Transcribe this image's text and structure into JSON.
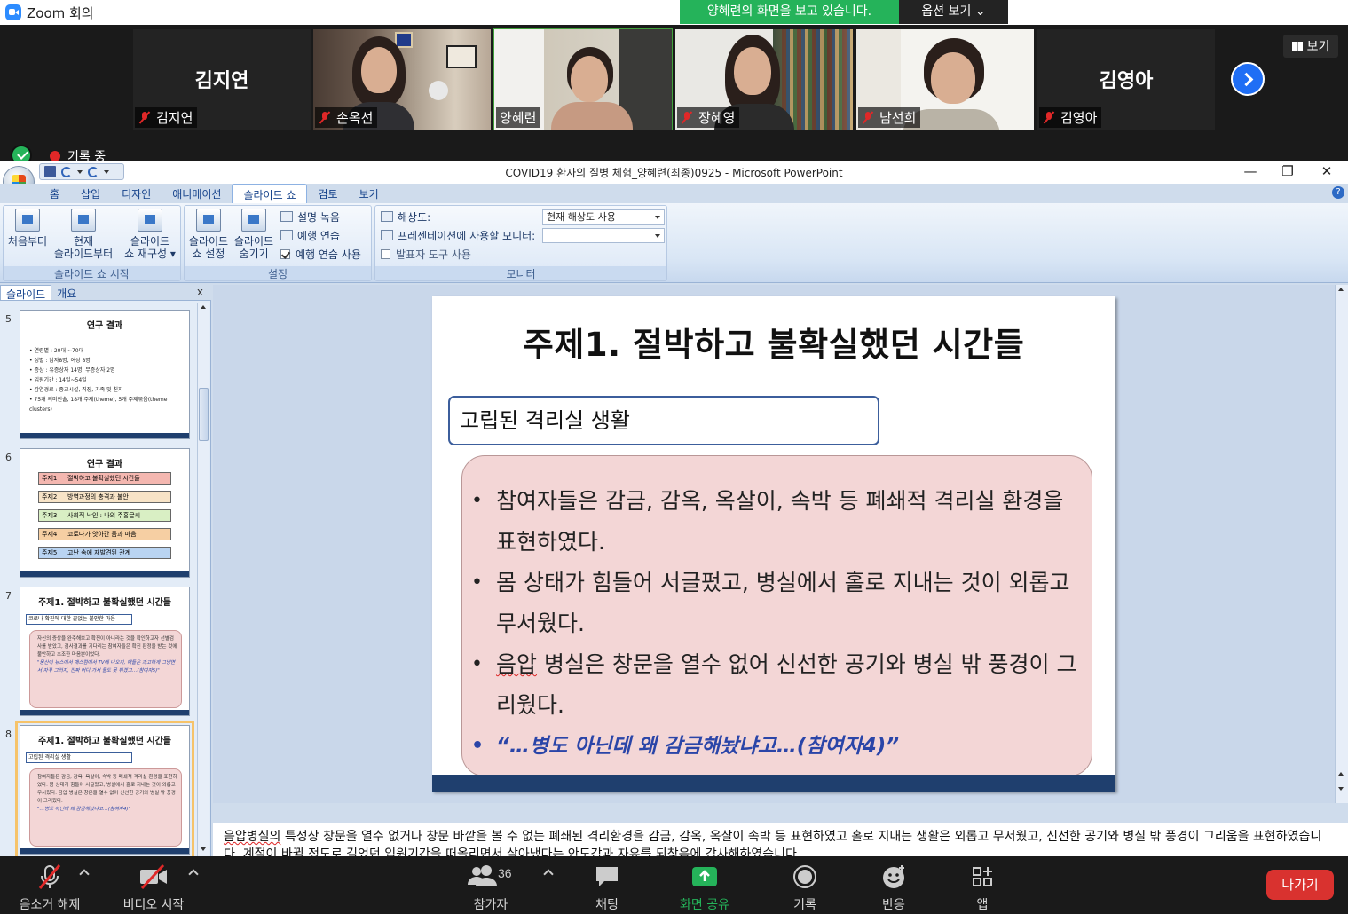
{
  "zoom": {
    "window_title": "Zoom 회의",
    "share_banner": "양혜련의 화면을 보고 있습니다.",
    "view_options": "옵션 보기",
    "view_button": "보기",
    "recording": "기록 중"
  },
  "participants": [
    {
      "name": "김지연",
      "big_name": "김지연",
      "muted": true,
      "video": false
    },
    {
      "name": "손옥선",
      "muted": true,
      "video": true
    },
    {
      "name": "양혜련",
      "muted": false,
      "video": true,
      "active": true
    },
    {
      "name": "장혜영",
      "muted": true,
      "video": true
    },
    {
      "name": "남선희",
      "muted": true,
      "video": true
    },
    {
      "name": "김영아",
      "big_name": "김영아",
      "muted": true,
      "video": false
    }
  ],
  "ppt": {
    "window_title": "COVID19 환자의 질병 체험_양혜련(최종)0925 - Microsoft PowerPoint",
    "tabs": [
      "홈",
      "삽입",
      "디자인",
      "애니메이션",
      "슬라이드 쇼",
      "검토",
      "보기"
    ],
    "active_tab": "슬라이드 쇼",
    "ribbon": {
      "from_start": "처음부터",
      "from_current_1": "현재",
      "from_current_2": "슬라이드부터",
      "custom_1": "슬라이드",
      "custom_2": "쇼 재구성 ▾",
      "group_start": "슬라이드 쇼 시작",
      "setup_1": "슬라이드",
      "setup_2": "쇼 설정",
      "hide_1": "슬라이드",
      "hide_2": "숨기기",
      "record": "설명 녹음",
      "rehearse": "예행 연습",
      "use_rehearse": "예행 연습 사용",
      "group_setup": "설정",
      "resolution_label": "해상도:",
      "resolution_value": "현재 해상도 사용",
      "monitor_label": "프레젠테이션에 사용할 모니터:",
      "monitor_value": "",
      "presenter_tools": "발표자 도구 사용",
      "group_monitor": "모니터"
    },
    "panel_tabs": [
      "슬라이드",
      "개요"
    ],
    "panel_close": "x",
    "thumbnails": [
      {
        "num": "5",
        "title": "연구 결과",
        "items": [
          "연령별 : 20대 ~70대",
          "성별 : 남자8명, 여성 8명",
          "증상 : 유증상자 14명, 무증상자 2명",
          "입원기간 : 14일~54일",
          "감염경로 : 종교시설, 직장, 가족 및 친지",
          "75개 의미진술, 18개 주제(theme), 5개 주제묶음(theme clusters)"
        ]
      },
      {
        "num": "6",
        "title": "연구 결과",
        "rows": [
          {
            "key": "주제1",
            "text": "절박하고 불확실했던 시간들",
            "color": "#f4b7b0"
          },
          {
            "key": "주제2",
            "text": "방역과정의 충격과 불안",
            "color": "#f7e3c7"
          },
          {
            "key": "주제3",
            "text": "사회적 낙인 : 나의 주홍글씨",
            "color": "#d9efc4"
          },
          {
            "key": "주제4",
            "text": "코로나가 앗아간 몸과 마음",
            "color": "#f6cfa3"
          },
          {
            "key": "주제5",
            "text": "고난 속에 재발견된 관계",
            "color": "#b9d4f2"
          }
        ]
      },
      {
        "num": "7",
        "title": "주제1. 절박하고 불확실했던 시간들",
        "box": "코로나 확진에 대한 끝없는 불안한 마음",
        "body": "자신의 증상을 완주해보고 확진이 아니라는 것을 확인하고자 선별검사를 받았고, 검사결과를 기다리는 참여자들은 확진 판정을 받는 것에 불안하고 초조한 마음뿐이었다.",
        "quote": "\"뭉산이 뉴스에서 매스컴에서 TV에 나오지, 애들은 과고하게 그냥면서 자꾸 그러지, 진짜 어디 가서 물도 못 뛰겠고…(참여자5)\""
      },
      {
        "num": "8",
        "title": "주제1. 절박하고 불확실했던 시간들",
        "selected": true,
        "box": "고립된 격리실 생활",
        "body": "참여자들은 감금, 감옥, 옥살이, 속박 등 폐쇄적 격리실 환경을 표현하였다. 몸 상태가 힘들어 서글펐고, 병실에서 홀로 지내는 것이 외롭고 무서웠다. 음압 병실은 창문을 열수 없어 신선한 공기와 병실 밖 풍경이 그리웠다.",
        "quote": "\"…병도 아닌데 왜 감금해놨냐고…(참여자4)\""
      }
    ],
    "slide": {
      "title": "주제1. 절박하고 불확실했던 시간들",
      "subtitle": "고립된 격리실 생활",
      "bullet1": "참여자들은 감금, 감옥, 옥살이, 속박 등 폐쇄적 격리실 환경을 표현하였다.",
      "bullet2": "몸 상태가 힘들어 서글펐고, 병실에서 홀로 지내는 것이 외롭고 무서웠다.",
      "bullet3_a": "음압",
      "bullet3_b": " 병실은 창문을 열수 없어 신선한 공기와 병실 밖 풍경이 그리웠다.",
      "quote": "“…병도 아닌데 왜 감금해놨냐고…(참여자4)”"
    },
    "notes_a": "음압병실의",
    "notes_b": " 특성상 창문을 열수 없거나 창문 바깥을 볼 수 없는 폐쇄된 격리환경을 감금, 감옥, 옥살이 속박 등  표현하였고  홀로 지내는 생활은 외롭고 무서웠고,  신선한 공기와 병실 밖 풍경이  그리움을 표현하였습니다. 계절이 바뀔 정도로 길었던 입원기간을 떠올리면서 살아냈다는 안도감과 자유를 되찾음에 감사해하였습니다."
  },
  "toolbar": {
    "unmute": "음소거 해제",
    "start_video": "비디오 시작",
    "participants": "참가자",
    "participants_count": "36",
    "chat": "채팅",
    "share": "화면 공유",
    "record": "기록",
    "reactions": "반응",
    "apps": "앱",
    "leave": "나가기"
  },
  "colors": {
    "share_green": "#25b35a",
    "leave_red": "#d9322f",
    "slide_footer": "#1f3f6e",
    "content_pink": "#f3d6d6",
    "quote_blue": "#2a45a8"
  }
}
